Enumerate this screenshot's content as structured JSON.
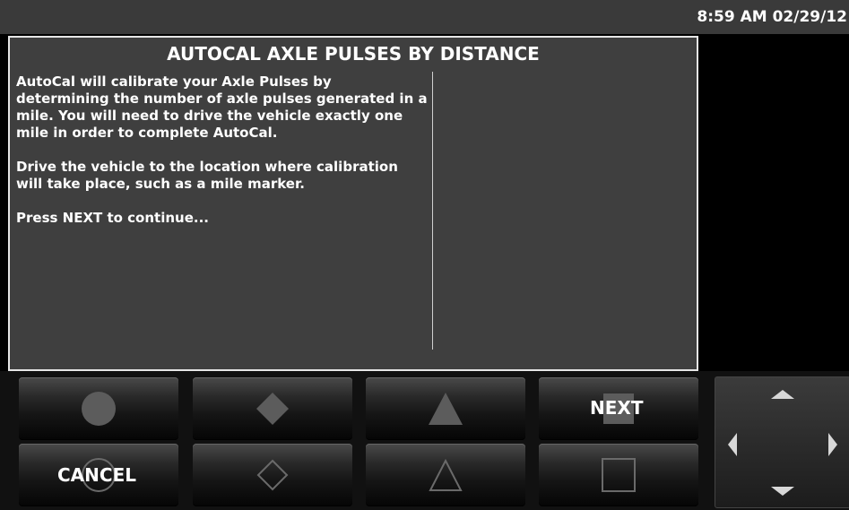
{
  "header": {
    "clock": "8:59 AM 02/29/12"
  },
  "panel": {
    "title": "AUTOCAL AXLE PULSES BY DISTANCE",
    "paragraphs": [
      "AutoCal will calibrate your Axle Pulses by determining the number of axle pulses generated in a mile. You will need to drive the vehicle exactly one mile in order to complete AutoCal.",
      "Drive the vehicle to the location where calibration will take place, such as a mile marker.",
      "Press NEXT to continue..."
    ]
  },
  "keys": {
    "next_label": "NEXT",
    "cancel_label": "CANCEL"
  },
  "icons": {
    "row1": [
      "circle-filled-icon",
      "diamond-filled-icon",
      "triangle-filled-icon",
      "square-filled-icon"
    ],
    "row2": [
      "circle-outline-icon",
      "diamond-outline-icon",
      "triangle-outline-icon",
      "square-outline-icon"
    ],
    "dpad": [
      "up-arrow-icon",
      "down-arrow-icon",
      "left-arrow-icon",
      "right-arrow-icon"
    ]
  }
}
